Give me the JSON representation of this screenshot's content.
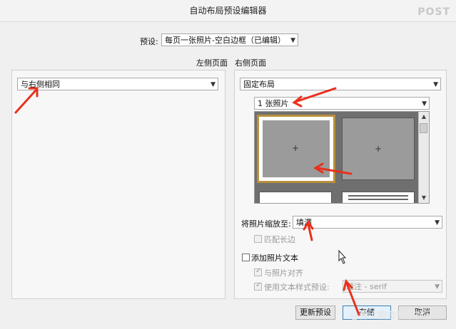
{
  "window": {
    "title": "自动布局预设编辑器",
    "watermark": "POST"
  },
  "preset": {
    "label": "预设:",
    "value": "每页一张照片-空白边框（已编辑）"
  },
  "left_panel": {
    "title": "左侧页面",
    "layout_value": "与右侧相同"
  },
  "right_panel": {
    "title": "右侧页面",
    "layout_value": "固定布局",
    "photo_count_value": "1 张照片",
    "scale_label": "将照片缩放至:",
    "scale_value": "填满",
    "match_long_edge": {
      "label": "匹配长边",
      "checked": false,
      "disabled": true
    },
    "add_photo_text": {
      "label": "添加照片文本",
      "checked": false
    },
    "align_with_photo": {
      "label": "与照片对齐",
      "checked": true,
      "disabled": true
    },
    "use_text_style": {
      "label": "使用文本样式预设:",
      "checked": true,
      "disabled": true
    },
    "text_style_value": "题注 - serif"
  },
  "buttons": {
    "update_preset": "更新预设",
    "save": "存储",
    "cancel": "取消"
  },
  "footer_watermark": "@稀土掘金技术社区",
  "colors": {
    "selected_cell_border": "#b8913d",
    "annotation_arrow": "#e8311d",
    "preview_bg": "#6f6f6f"
  }
}
